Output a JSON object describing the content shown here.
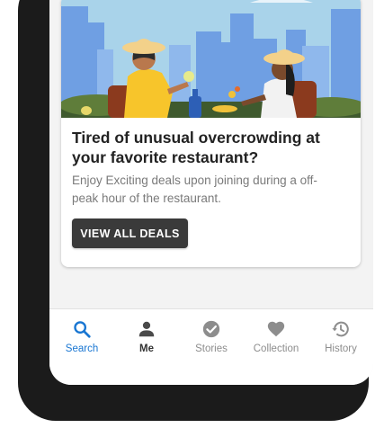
{
  "card": {
    "title": "Tired of unusual overcrowding at your favorite restaurant?",
    "body": "Enjoy Exciting deals upon joining during a off-peak hour of the restaurant.",
    "cta_label": "VIEW ALL DEALS"
  },
  "bottom_nav": {
    "items": [
      {
        "label": "Search",
        "icon": "search-icon",
        "state": "selected"
      },
      {
        "label": "Me",
        "icon": "person-icon",
        "state": "bold"
      },
      {
        "label": "Stories",
        "icon": "check-circle-icon",
        "state": "default"
      },
      {
        "label": "Collection",
        "icon": "heart-icon",
        "state": "default"
      },
      {
        "label": "History",
        "icon": "history-icon",
        "state": "default"
      }
    ]
  },
  "colors": {
    "accent": "#1976d2",
    "button_bg": "#3a3a3a",
    "nav_inactive": "#8d8d8d",
    "hero_sky": "#a9d3ea",
    "hero_buildings": "#6f9fe3"
  }
}
